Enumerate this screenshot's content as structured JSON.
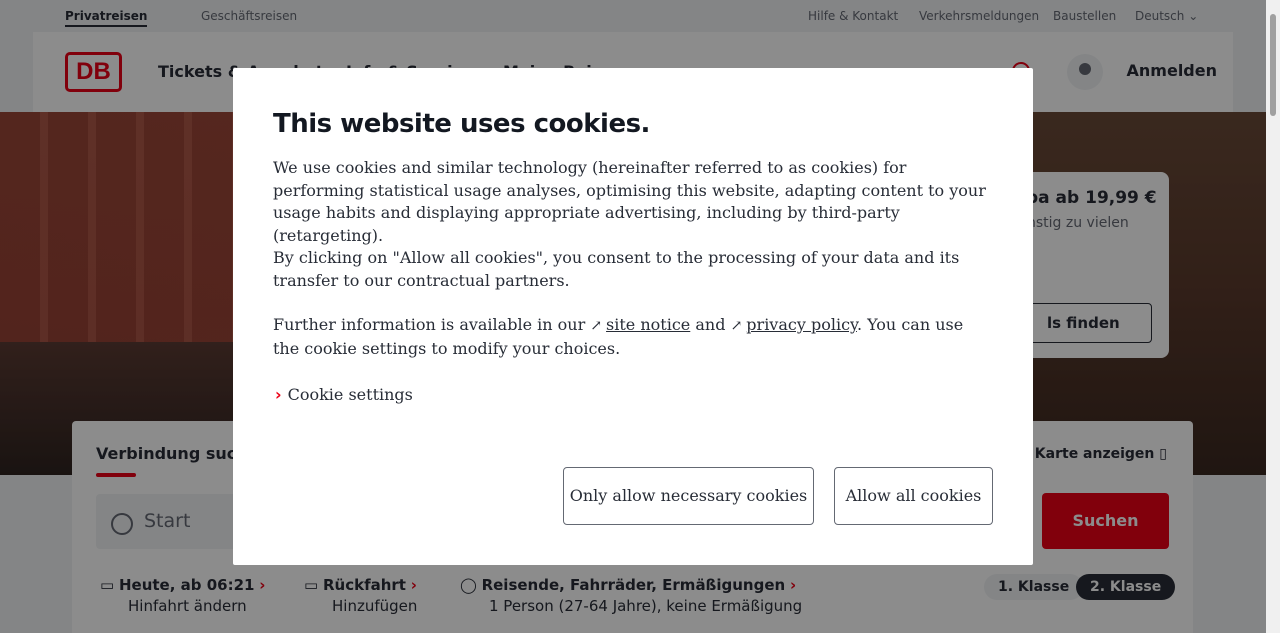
{
  "topbar": {
    "tabs": [
      "Privatreisen",
      "Geschäftsreisen"
    ],
    "links": [
      "Hilfe & Kontakt",
      "Verkehrsmeldungen",
      "Baustellen",
      "Deutsch"
    ]
  },
  "header": {
    "logo": "DB",
    "nav": [
      "Tickets & Angebote",
      "Info & Services",
      "Meine Reisen"
    ],
    "login": "Anmelden"
  },
  "promo": {
    "title": "pa ab 19,99 €",
    "subtitle": "nstig zu vielen",
    "button": "ls finden"
  },
  "search": {
    "title": "Verbindung suchen",
    "map_link": "Karte anzeigen",
    "start_placeholder": "Start",
    "search_button": "Suchen",
    "date_label": "Heute, ab 06:21",
    "date_sub": "Hinfahrt ändern",
    "return_label": "Rückfahrt",
    "return_sub": "Hinzufügen",
    "travelers_label": "Reisende, Fahrräder, Ermäßigungen",
    "travelers_sub": "1 Person (27-64 Jahre), keine Ermäßigung",
    "class1": "1. Klasse",
    "class2": "2. Klasse"
  },
  "modal": {
    "title": "This website uses cookies.",
    "para1": "We use cookies and similar technology (hereinafter referred to as cookies) for performing statistical usage analyses, optimising this website, adapting content to your usage habits and displaying appropriate advertising, including by third-party (retargeting).",
    "para2": "By clicking on \"Allow all cookies\", you consent to the processing of your data and its transfer to our contractual partners.",
    "para3_pre": "Further information is available in our",
    "site_notice": "site notice",
    "para3_and": "and",
    "privacy_policy": "privacy policy",
    "para3_post": ". You can use the cookie settings to modify your choices.",
    "settings_label": "Cookie settings",
    "btn_necessary": "Only allow necessary cookies",
    "btn_all": "Allow all cookies"
  }
}
